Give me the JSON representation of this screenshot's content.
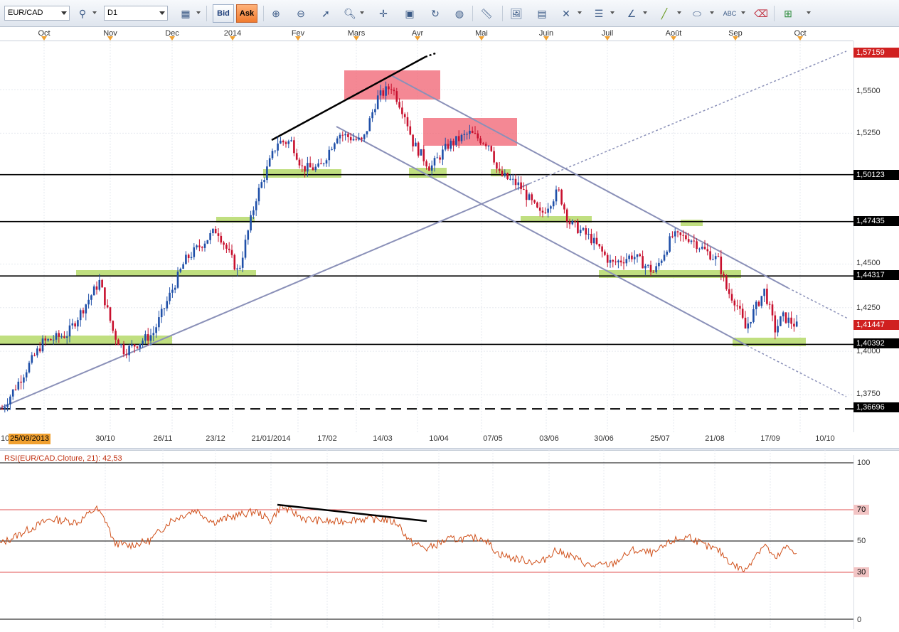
{
  "toolbar": {
    "symbol": "EUR/CAD",
    "timeframe": "D1",
    "bid_label": "Bid",
    "ask_label": "Ask"
  },
  "months": [
    "Oct",
    "Nov",
    "Dec",
    "2014",
    "Fev",
    "Mars",
    "Avr",
    "Mai",
    "Juin",
    "Juil",
    "Août",
    "Sep",
    "Oct"
  ],
  "dates": [
    "30/10",
    "26/11",
    "23/12",
    "21/01/2014",
    "17/02",
    "14/03",
    "10/04",
    "07/05",
    "03/06",
    "30/06",
    "25/07",
    "21/08",
    "17/09",
    "10/10"
  ],
  "start_date": "25/09/2013",
  "start_fragment": "10",
  "price_labels": {
    "p1": "1,57159",
    "p2": "1,5500",
    "p3": "1,5250",
    "p4": "1,50123",
    "p5": "1,47435",
    "p6": "1,4500",
    "p7": "1,44317",
    "p8": "1,4250",
    "p9": "1,41447",
    "p10": "1,40392",
    "p11": "1,4000",
    "p12": "1,3750",
    "p13": "1,36696"
  },
  "rsi": {
    "title": "RSI(EUR/CAD.Cloture, 21): 42,53",
    "levels": [
      "100",
      "70",
      "50",
      "30",
      "0"
    ]
  },
  "colors": {
    "bull": "#1f4fa8",
    "bear": "#c8102e",
    "support_zone": "#b5d96a",
    "resistance_zone": "#f06070",
    "trendline": "#8a90b8",
    "rsi_line": "#d0501a"
  },
  "chart_data": {
    "type": "line",
    "title": "EUR/CAD D1",
    "x": [
      "25/09/2013",
      "30/10",
      "26/11",
      "23/12",
      "21/01/2014",
      "17/02",
      "14/03",
      "10/04",
      "07/05",
      "03/06",
      "30/06",
      "25/07",
      "21/08",
      "17/09"
    ],
    "series": [
      {
        "name": "EUR/CAD",
        "values": [
          1.367,
          1.44,
          1.403,
          1.462,
          1.502,
          1.525,
          1.552,
          1.505,
          1.518,
          1.474,
          1.451,
          1.466,
          1.441,
          1.414
        ]
      },
      {
        "name": "RSI",
        "values": [
          48,
          68,
          47,
          62,
          72,
          64,
          62,
          51,
          47,
          39,
          38,
          51,
          37,
          43
        ]
      }
    ],
    "horizontal_levels": [
      1.50123,
      1.47435,
      1.44317,
      1.40392,
      1.36696
    ],
    "last_price": 1.41447,
    "ylim": [
      1.36,
      1.575
    ],
    "rsi_levels": [
      30,
      50,
      70
    ],
    "rsi_last": 42.53
  }
}
